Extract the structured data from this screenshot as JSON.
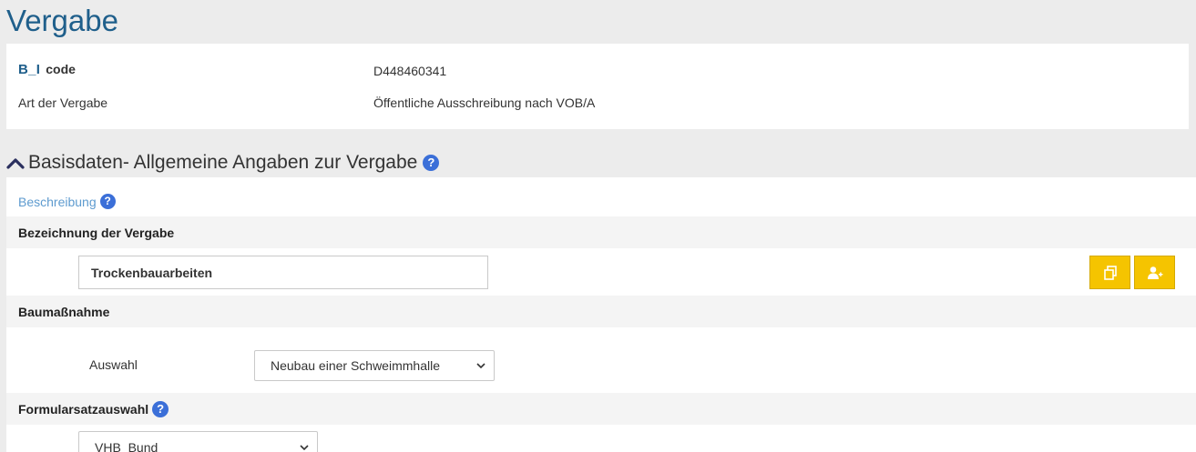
{
  "page": {
    "title": "Vergabe"
  },
  "info": {
    "bi_logo": "B_I",
    "code_label": "code",
    "code_value": "D448460341",
    "art_label": "Art der Vergabe",
    "art_value": "Öffentliche Ausschreibung nach VOB/A"
  },
  "section": {
    "title": "Basisdaten- Allgemeine Angaben zur Vergabe",
    "help_glyph": "?"
  },
  "beschreibung": {
    "label": "Beschreibung",
    "help_glyph": "?"
  },
  "bezeichnung": {
    "label": "Bezeichnung der Vergabe",
    "value": "Trockenbauarbeiten"
  },
  "baumassnahme": {
    "label": "Baumaßnahme",
    "auswahl_label": "Auswahl",
    "selected": "Neubau einer Schweimmhalle"
  },
  "formularsatz": {
    "label": "Formularsatzauswahl",
    "help_glyph": "?",
    "selected": "VHB_Bund"
  },
  "icons": {
    "copy_button": "copy-icon",
    "add_user_button": "add-user-icon",
    "collapse": "chevron-up-icon"
  },
  "colors": {
    "accent_blue": "#1f5f8b",
    "link_blue": "#5e9bcf",
    "help_blue": "#3b6fd8",
    "button_yellow": "#f5c400"
  }
}
